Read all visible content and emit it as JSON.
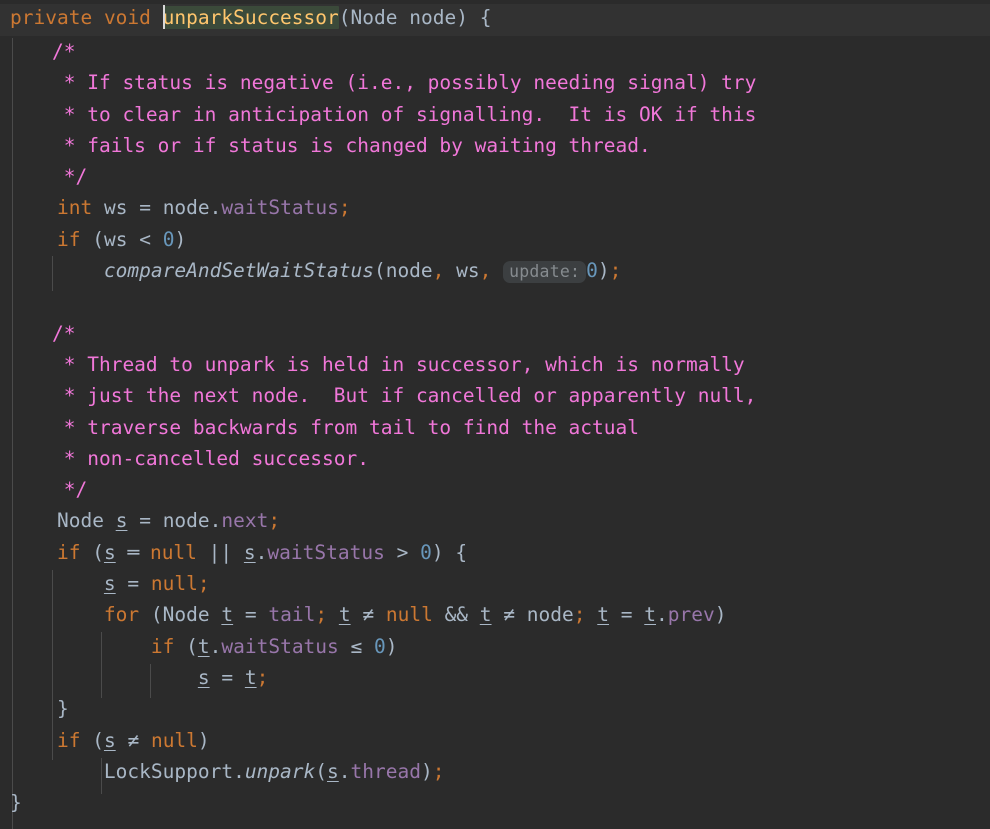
{
  "editor": {
    "language": "java",
    "theme": "darcula",
    "background": "#2b2b2b",
    "caret_row_background": "#323232",
    "colors": {
      "keyword": "#cc7832",
      "identifier": "#a9b7c6",
      "field": "#9876aa",
      "number": "#6897bb",
      "comment": "#f177d9",
      "method_declaration": "#ffc66d",
      "declaration_highlight_bg": "#3b4a3a",
      "inlay_hint_bg": "#3c3f41",
      "inlay_hint_text": "#868b8f",
      "indent_guide": "#4b4b4b",
      "caret": "#d8d8d8"
    },
    "signature": {
      "modifier": "private",
      "return_type": "void",
      "name": "unparkSuccessor",
      "open_paren": "(",
      "param_type": "Node",
      "param_name": "node",
      "close_paren": ")",
      "brace": "{"
    },
    "inlay_hints": [
      {
        "label": "update:",
        "for_argument": "0"
      }
    ],
    "comment_block_1": [
      "/*",
      " * If status is negative (i.e., possibly needing signal) try",
      " * to clear in anticipation of signalling.  It is OK if this",
      " * fails or if status is changed by waiting thread.",
      " */"
    ],
    "comment_block_2": [
      "/*",
      " * Thread to unpark is held in successor, which is normally",
      " * just the next node.  But if cancelled or apparently null,",
      " * traverse backwards from tail to find the actual",
      " * non-cancelled successor.",
      " */"
    ],
    "code_lines": [
      "int ws = node.waitStatus;",
      "if (ws < 0)",
      "compareAndSetWaitStatus(node, ws, update: 0);",
      "Node s = node.next;",
      "if (s == null || s.waitStatus > 0) {",
      "s = null;",
      "for (Node t = tail; t != null && t != node; t = t.prev)",
      "if (t.waitStatus <= 0)",
      "s = t;",
      "}",
      "if (s != null)",
      "LockSupport.unpark(s.thread);",
      "}"
    ],
    "tokens": {
      "kw_private": "private",
      "kw_void": "void",
      "kw_int": "int",
      "kw_if": "if",
      "kw_for": "for",
      "kw_null": "null",
      "type_Node": "Node",
      "type_LockSupport": "LockSupport",
      "var_node": "node",
      "var_ws": "ws",
      "var_s": "s",
      "var_t": "t",
      "field_waitStatus": "waitStatus",
      "field_next": "next",
      "field_prev": "prev",
      "field_tail": "tail",
      "field_thread": "thread",
      "method_compareAndSetWaitStatus": "compareAndSetWaitStatus",
      "method_unpark": "unpark",
      "num_zero": "0",
      "op_assign": "=",
      "op_lt": "<",
      "op_gt": ">",
      "op_eq": "==",
      "op_neq": "!=",
      "op_lte": "<=",
      "op_or": "||",
      "op_and": "&&",
      "semicolon": ";",
      "comma": ",",
      "dot": ".",
      "lparen": "(",
      "rparen": ")",
      "lbrace": "{",
      "rbrace": "}"
    },
    "ligatures": {
      "eq": "═",
      "neq": "≠",
      "lte": "≤"
    }
  }
}
